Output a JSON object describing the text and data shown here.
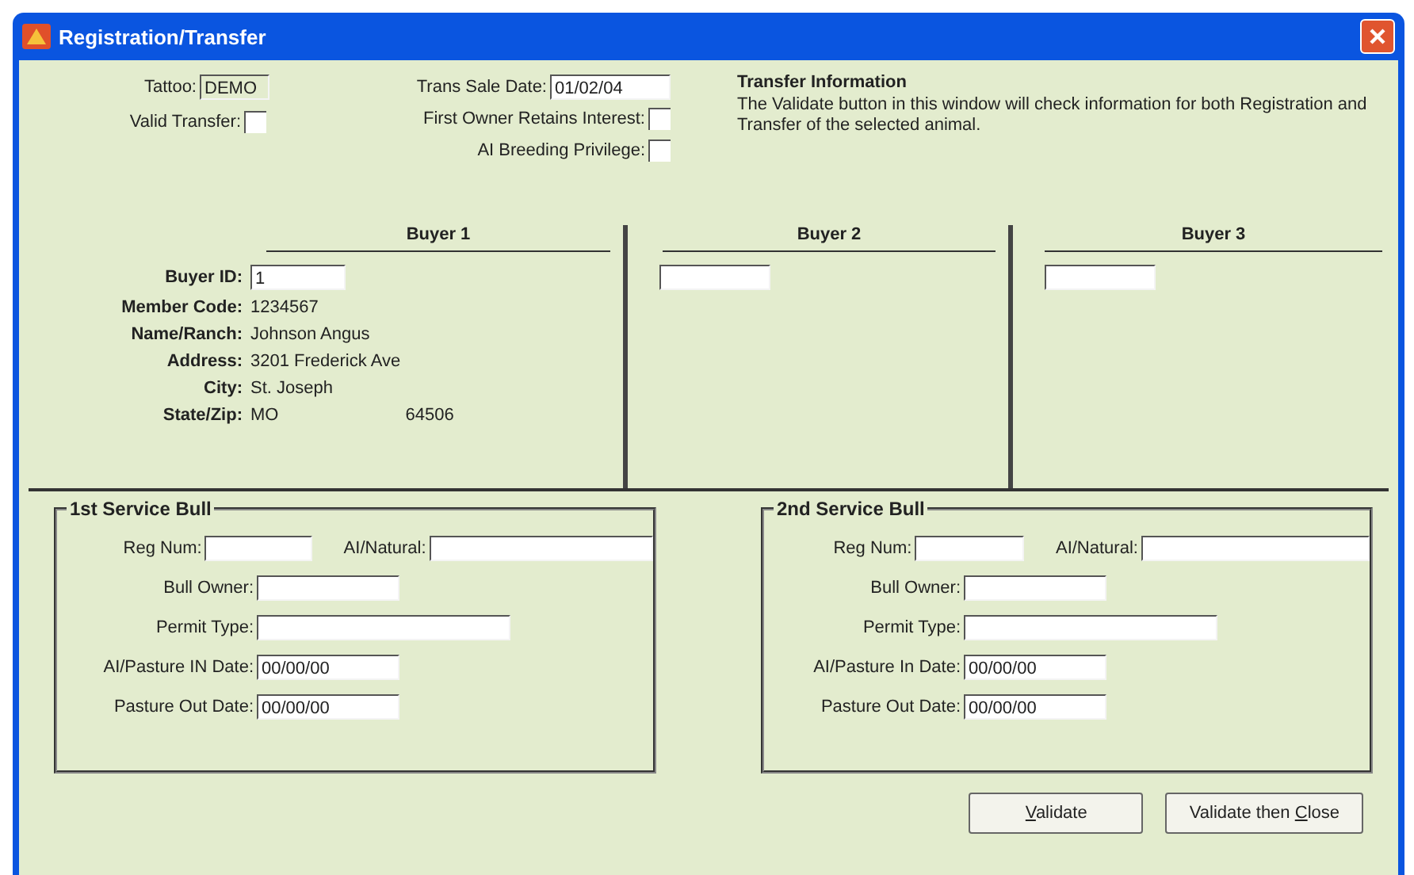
{
  "window": {
    "title": "Registration/Transfer"
  },
  "top": {
    "tattoo": {
      "label": "Tattoo:",
      "value": "DEMO"
    },
    "valid_transfer": {
      "label": "Valid Transfer:",
      "checked": false
    },
    "trans_sale_date": {
      "label": "Trans Sale Date:",
      "value": "01/02/04"
    },
    "options": [
      {
        "label": "First Owner Retains Interest:",
        "checked": false
      },
      {
        "label": "AI Breeding Privilege:",
        "checked": false
      }
    ]
  },
  "info": {
    "title": "Transfer Information",
    "text": "The Validate button in this window will check information for both Registration and Transfer of the selected animal."
  },
  "buyers": [
    {
      "heading": "Buyer 1",
      "id_label": "Buyer ID:",
      "buyer_id": "1",
      "details": [
        {
          "label": "Member Code:",
          "value": "1234567"
        },
        {
          "label": "Name/Ranch:",
          "value": "Johnson Angus"
        },
        {
          "label": "Address:",
          "value": "3201 Frederick Ave"
        },
        {
          "label": "City:",
          "value": "St. Joseph"
        },
        {
          "label": "State/Zip:",
          "value": "MO",
          "value_2": "64506"
        }
      ]
    },
    {
      "heading": "Buyer 2"
    },
    {
      "heading": "Buyer 3"
    }
  ],
  "service_bulls": [
    {
      "title": "1st Service Bull",
      "rows": [
        [
          {
            "label": "Reg Num:",
            "kind": "short"
          },
          {
            "label": "AI/Natural:",
            "kind": "long"
          }
        ],
        [
          {
            "label": "Bull Owner:",
            "kind": "medium"
          }
        ],
        [
          {
            "label": "Permit Type:",
            "kind": "long"
          }
        ],
        [
          {
            "label": "AI/Pasture IN Date:",
            "kind": "medium",
            "value": "00/00/00"
          }
        ],
        [
          {
            "label": "Pasture Out Date:",
            "kind": "medium",
            "value": "00/00/00"
          }
        ]
      ]
    },
    {
      "title": "2nd Service Bull",
      "rows": [
        [
          {
            "label": "Reg Num:",
            "kind": "short"
          },
          {
            "label": "AI/Natural:",
            "kind": "long"
          }
        ],
        [
          {
            "label": "Bull Owner:",
            "kind": "medium"
          }
        ],
        [
          {
            "label": "Permit Type:",
            "kind": "long"
          }
        ],
        [
          {
            "label": "AI/Pasture In Date:",
            "kind": "medium",
            "value": "00/00/00"
          }
        ],
        [
          {
            "label": "Pasture Out Date:",
            "kind": "medium",
            "value": "00/00/00"
          }
        ]
      ]
    }
  ],
  "buttons": [
    {
      "parts": [
        {
          "text": "V",
          "underlined": true
        },
        {
          "text": "alidate",
          "underlined": false
        }
      ]
    },
    {
      "parts": [
        {
          "text": "Validate then ",
          "underlined": false
        },
        {
          "text": "C",
          "underlined": true
        },
        {
          "text": "lose",
          "underlined": false
        }
      ]
    }
  ]
}
